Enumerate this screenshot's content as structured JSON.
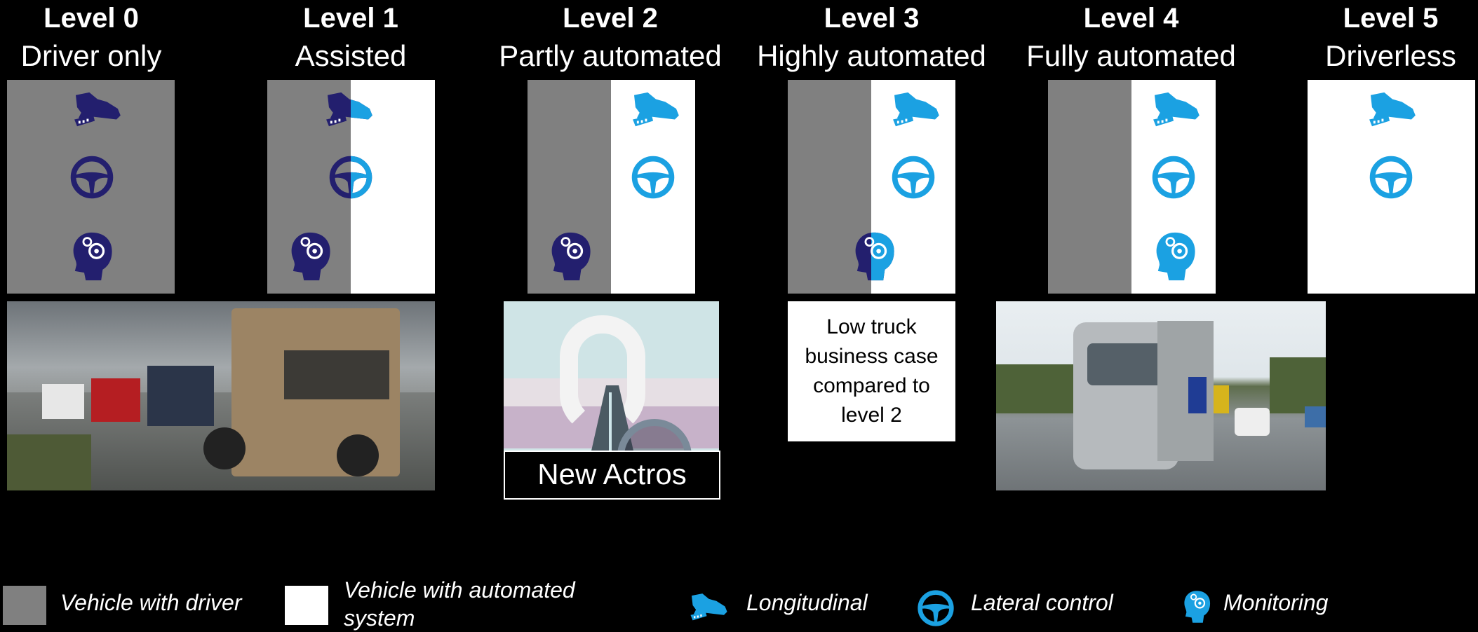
{
  "levels": [
    {
      "title": "Level 0",
      "subtitle": "Driver only"
    },
    {
      "title": "Level 1",
      "subtitle": "Assisted"
    },
    {
      "title": "Level 2",
      "subtitle": "Partly automated"
    },
    {
      "title": "Level 3",
      "subtitle": "Highly automated"
    },
    {
      "title": "Level 4",
      "subtitle": "Fully automated"
    },
    {
      "title": "Level 5",
      "subtitle": "Driverless"
    }
  ],
  "images": {
    "actros_caption": "New Actros"
  },
  "note_level3": "Low truck business case compared to level 2",
  "legend": {
    "driver": "Vehicle with driver",
    "automated": "Vehicle with automated system",
    "longitudinal": "Longitudinal",
    "lateral": "Lateral control",
    "monitoring": "Monitoring"
  },
  "colors": {
    "driver_icon": "#231f6e",
    "system_icon": "#1ba1e2",
    "driver_bg": "#808080",
    "system_bg": "#ffffff"
  }
}
